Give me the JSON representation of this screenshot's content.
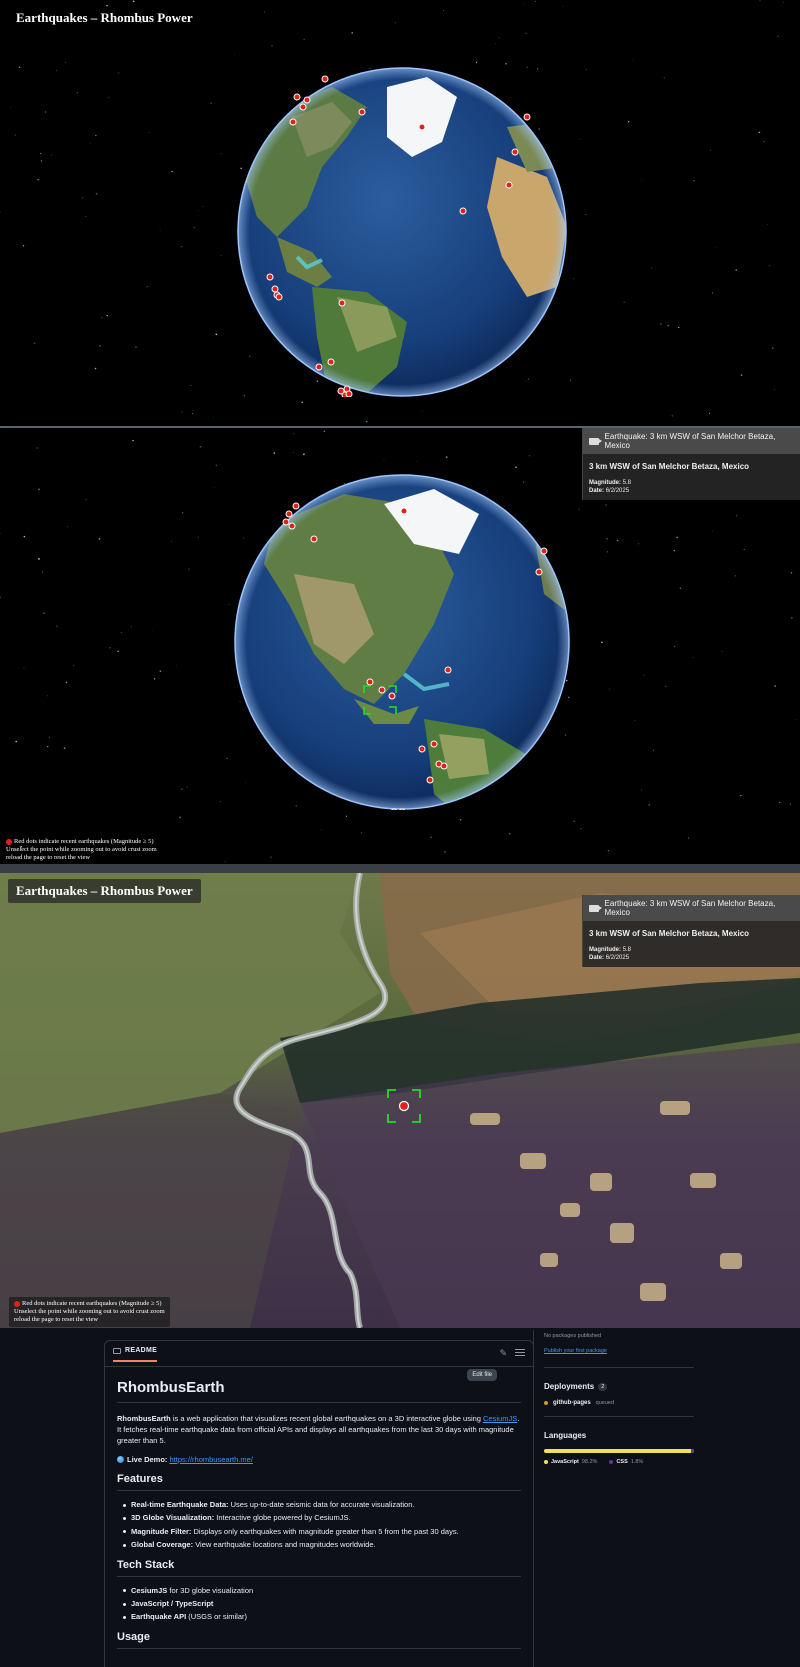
{
  "app": {
    "title": "Earthquakes – Rhombus Power",
    "legend": {
      "line1": "Red dots indicate recent earthquakes (Magnitude ≥ 5)",
      "line2": "Unselect the point while zooming out to avoid crust zoom",
      "line3": "reload the page to reset the view"
    },
    "infobox": {
      "header": "Earthquake: 3 km WSW of San Melchor Betaza, Mexico",
      "title": "3 km WSW of San Melchor Betaza, Mexico",
      "magnitude_label": "Magnitude:",
      "magnitude": "5.8",
      "date_label": "Date:",
      "date": "6/2/2025"
    },
    "colors": {
      "quake_dot": "#e0201a",
      "selection_box": "#20e020"
    },
    "icons": [
      "camera-icon",
      "earthquake-dot-icon",
      "selection-box-icon"
    ]
  },
  "readme": {
    "tab_label": "README",
    "edit_tooltip": "Edit file",
    "title": "RhombusEarth",
    "intro_bold": "RhombusEarth",
    "intro_1": " is a web application that visualizes recent global earthquakes on a 3D interactive globe using ",
    "intro_link": "CesiumJS",
    "intro_2": ". It fetches real-time earthquake data from official APIs and displays all earthquakes from the last 30 days with magnitude greater than 5.",
    "demo_label": "Live Demo:",
    "demo_link": "https://rhombusearth.me/",
    "features_heading": "Features",
    "features": [
      {
        "bold": "Real-time Earthquake Data:",
        "text": " Uses up-to-date seismic data for accurate visualization."
      },
      {
        "bold": "3D Globe Visualization:",
        "text": " Interactive globe powered by CesiumJS."
      },
      {
        "bold": "Magnitude Filter:",
        "text": " Displays only earthquakes with magnitude greater than 5 from the past 30 days."
      },
      {
        "bold": "Global Coverage:",
        "text": " View earthquake locations and magnitudes worldwide."
      }
    ],
    "stack_heading": "Tech Stack",
    "stack": [
      {
        "bold": "CesiumJS",
        "text": " for 3D globe visualization"
      },
      {
        "bold": "JavaScript / TypeScript",
        "text": ""
      },
      {
        "bold": "Earthquake API",
        "text": " (USGS or similar)"
      }
    ],
    "usage_heading": "Usage"
  },
  "sidebar": {
    "no_packages": "No packages published",
    "publish_link": "Publish your first package",
    "deployments_heading": "Deployments",
    "deployments_count": "2",
    "deployment_name": "github-pages",
    "deployment_status": "queued",
    "languages_heading": "Languages",
    "languages": [
      {
        "name": "JavaScript",
        "percent": "98.2%",
        "color": "#f1e05a"
      },
      {
        "name": "CSS",
        "percent": "1.8%",
        "color": "#663399"
      }
    ]
  }
}
